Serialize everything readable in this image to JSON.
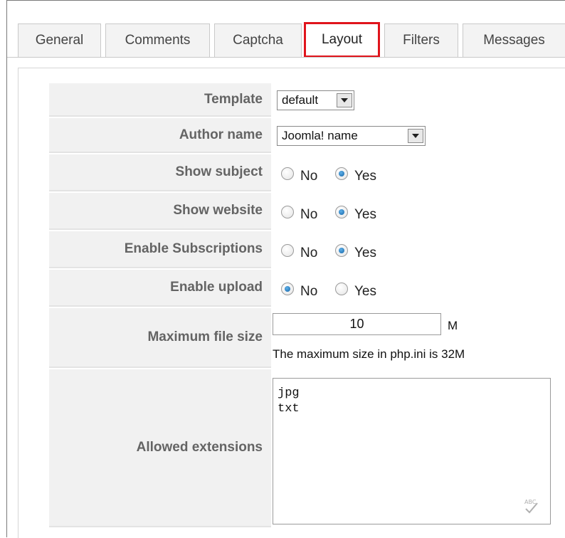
{
  "tabs": [
    {
      "label": "General"
    },
    {
      "label": "Comments"
    },
    {
      "label": "Captcha"
    },
    {
      "label": "Layout"
    },
    {
      "label": "Filters"
    },
    {
      "label": "Messages"
    }
  ],
  "active_tab": "Layout",
  "fields": {
    "template": {
      "label": "Template",
      "value": "default"
    },
    "author_name": {
      "label": "Author name",
      "value": "Joomla! name"
    },
    "show_subject": {
      "label": "Show subject",
      "no": "No",
      "yes": "Yes",
      "selected": "Yes"
    },
    "show_website": {
      "label": "Show website",
      "no": "No",
      "yes": "Yes",
      "selected": "Yes"
    },
    "enable_subscriptions": {
      "label": "Enable Subscriptions",
      "no": "No",
      "yes": "Yes",
      "selected": "Yes"
    },
    "enable_upload": {
      "label": "Enable upload",
      "no": "No",
      "yes": "Yes",
      "selected": "No"
    },
    "max_file_size": {
      "label": "Maximum file size",
      "value": "10",
      "unit": "M",
      "note": "The maximum size in php.ini is 32M"
    },
    "allowed_extensions": {
      "label": "Allowed extensions",
      "lines": [
        "jpg",
        "txt"
      ]
    }
  },
  "colors": {
    "highlight": "#e0141c",
    "radio_checked": "#1565a8"
  },
  "icons": {
    "dropdown": "chevron-down-icon",
    "spellcheck": "spellcheck-icon"
  }
}
